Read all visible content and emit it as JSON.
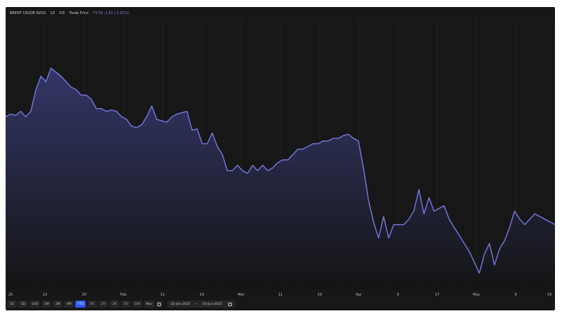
{
  "header": {
    "instrument": "BRENT CRUDE AVGS",
    "interval": "1D",
    "exchange": "ICE",
    "trade_label": "Trade Price",
    "trade_value": "73.58 -1.63 (-1.81%)"
  },
  "toolbar": {
    "ranges": [
      {
        "label": "1D",
        "active": false
      },
      {
        "label": "5D",
        "active": false
      },
      {
        "label": "10D",
        "active": false
      },
      {
        "label": "1M",
        "active": false
      },
      {
        "label": "3M",
        "active": false
      },
      {
        "label": "6M",
        "active": false
      },
      {
        "label": "YTD",
        "active": true
      },
      {
        "label": "1Y",
        "active": false
      },
      {
        "label": "2Y",
        "active": false
      },
      {
        "label": "3Y",
        "active": false
      },
      {
        "label": "5Y",
        "active": false
      },
      {
        "label": "10Y",
        "active": false
      },
      {
        "label": "Max",
        "active": false
      }
    ],
    "calendar_icon": "calendar-icon",
    "date_from": "02-Jan-2025",
    "date_separator": "~",
    "date_to": "16-Jun-2025"
  },
  "colors": {
    "frame_bg": "#171717",
    "line": "#6f74d8",
    "area_top": "#34386a",
    "area_bottom": "#141414",
    "axis_text": "#bdbdbd",
    "grid": "#232323",
    "active_button": "#2f56f2"
  },
  "chart_data": {
    "type": "area",
    "title": "",
    "xlabel": "",
    "ylabel": "",
    "ylim": [
      0,
      100
    ],
    "x_ticks": [
      "25",
      "13",
      "20",
      "Feb",
      "11",
      "19",
      "Mar",
      "11",
      "19",
      "Apr",
      "9",
      "17",
      "May",
      "9",
      "19"
    ],
    "series": [
      {
        "values": [
          64,
          65,
          64.5,
          66,
          64,
          66,
          74,
          79,
          77,
          82,
          80.5,
          79,
          77,
          75,
          74,
          72,
          72,
          70.5,
          67,
          67,
          66,
          66.5,
          66,
          64,
          63,
          60.5,
          60,
          61,
          64,
          68,
          63,
          62.5,
          62,
          64,
          65,
          65.5,
          66,
          59,
          59.5,
          54,
          54,
          58,
          53,
          50,
          44,
          44,
          46,
          44,
          43,
          46,
          44,
          46,
          44,
          45,
          47,
          48,
          48,
          50,
          52,
          52,
          53,
          54,
          54,
          55,
          55,
          56,
          56,
          57,
          57.5,
          56,
          55,
          45,
          33,
          25,
          19,
          27,
          19,
          24,
          24,
          24,
          26,
          29,
          37,
          28,
          34,
          29,
          30,
          31,
          26,
          23,
          20,
          17,
          14,
          10,
          6,
          13,
          17,
          9,
          15,
          18,
          23,
          29,
          26,
          24,
          26,
          28,
          27,
          26,
          25,
          24
        ]
      }
    ]
  }
}
